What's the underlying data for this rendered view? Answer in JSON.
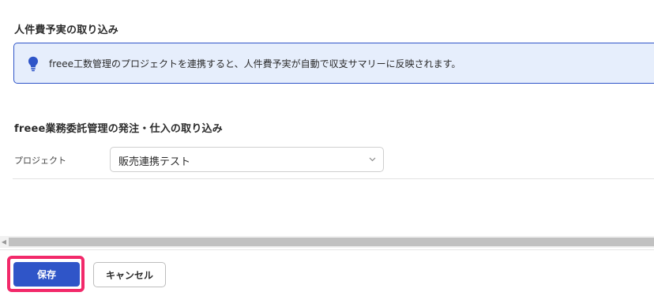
{
  "sections": {
    "personnel_import_title": "人件費予実の取り込み",
    "info_message": "freee工数管理のプロジェクトを連携すると、人件費予実が自動で収支サマリーに反映されます。",
    "info_icon": "lightbulb-icon",
    "outsourcing_import_title": "freee業務委託管理の発注・仕入の取り込み"
  },
  "form": {
    "project_label": "プロジェクト",
    "project_value": "販売連携テスト"
  },
  "footer": {
    "save_label": "保存",
    "cancel_label": "キャンセル"
  },
  "colors": {
    "primary": "#2f55c8",
    "info_background": "#e6eefc",
    "highlight": "#f2296a"
  }
}
